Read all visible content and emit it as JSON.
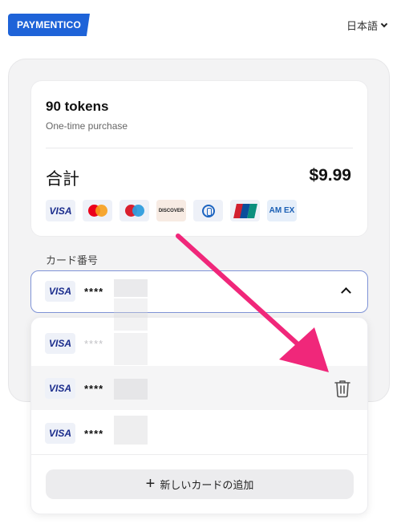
{
  "header": {
    "logo_text": "PAYMENTICO",
    "language": "日本語"
  },
  "summary": {
    "product_name": "90 tokens",
    "product_type": "One-time purchase",
    "total_label": "合計",
    "total_value": "$9.99"
  },
  "brands": {
    "visa": "VISA",
    "discover": "DISCOVER",
    "amex": "AM EX"
  },
  "card_field": {
    "label": "カード番号",
    "selected_brand": "VISA",
    "selected_masked": "****"
  },
  "saved_cards": [
    {
      "brand": "VISA",
      "masked": "****"
    },
    {
      "brand": "VISA",
      "masked": "****"
    },
    {
      "brand": "VISA",
      "masked": "****"
    }
  ],
  "add_card_label": "新しいカードの追加",
  "colors": {
    "brand_blue": "#1e63d8",
    "accent_border": "#7f93d6",
    "arrow": "#f0277a"
  }
}
